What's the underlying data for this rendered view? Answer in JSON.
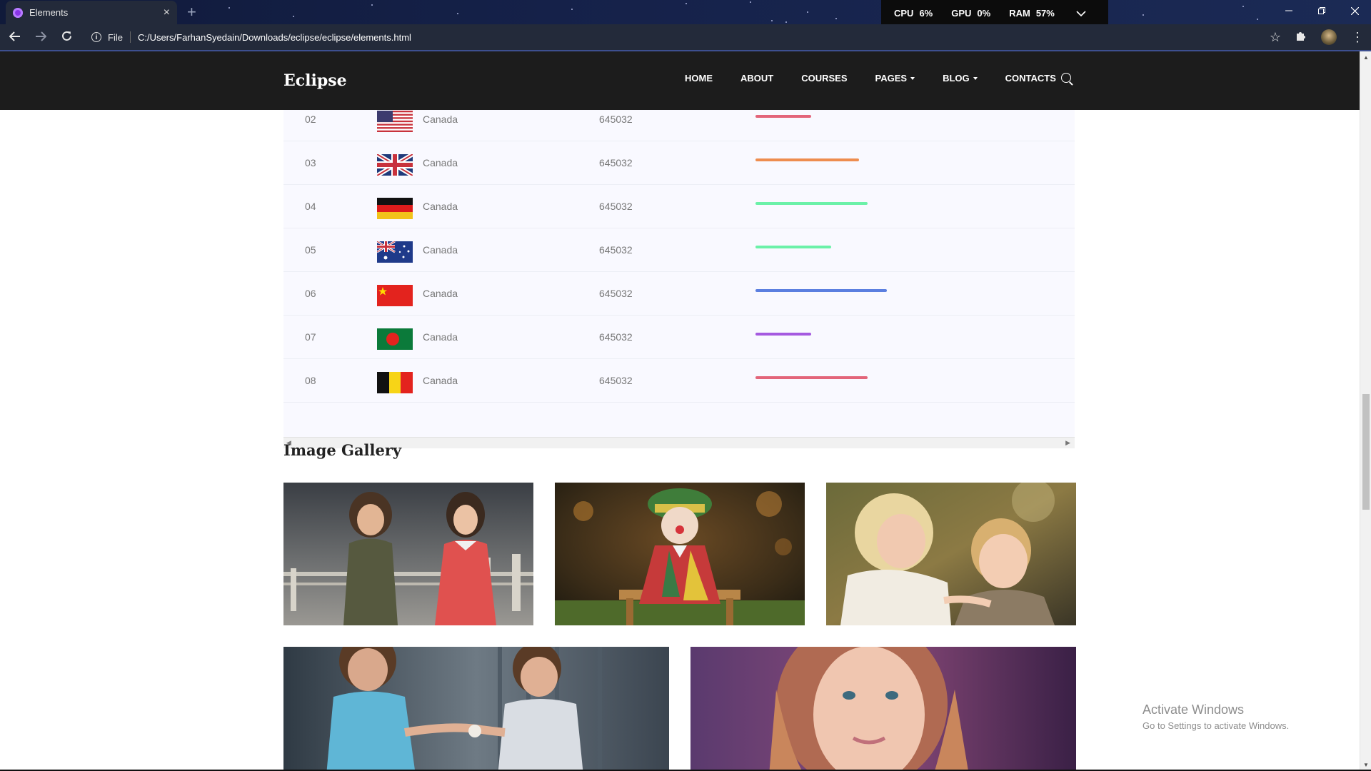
{
  "browser": {
    "tab_title": "Elements",
    "tab_close": "×",
    "new_tab": "+",
    "perf": [
      {
        "label": "CPU",
        "value": "6%"
      },
      {
        "label": "GPU",
        "value": "0%"
      },
      {
        "label": "RAM",
        "value": "57%"
      }
    ],
    "file_label": "File",
    "url": "C:/Users/FarhanSyedain/Downloads/eclipse/eclipse/elements.html"
  },
  "site": {
    "logo": "Eclipse",
    "menu": [
      {
        "label": "HOME",
        "dropdown": false
      },
      {
        "label": "ABOUT",
        "dropdown": false
      },
      {
        "label": "COURSES",
        "dropdown": false
      },
      {
        "label": "PAGES",
        "dropdown": true
      },
      {
        "label": "BLOG",
        "dropdown": true
      },
      {
        "label": "CONTACTS",
        "dropdown": false
      }
    ]
  },
  "table": {
    "rows": [
      {
        "serial": "02",
        "flag": "usa-flag",
        "country": "Canada",
        "visit": "645032",
        "percent": 20,
        "color": "#e3657a"
      },
      {
        "serial": "03",
        "flag": "uk-flag",
        "country": "Canada",
        "visit": "645032",
        "percent": 37,
        "color": "#ee8d4f"
      },
      {
        "serial": "04",
        "flag": "germany-flag",
        "country": "Canada",
        "visit": "645032",
        "percent": 40,
        "color": "#6bf1a8"
      },
      {
        "serial": "05",
        "flag": "australia-flag",
        "country": "Canada",
        "visit": "645032",
        "percent": 27,
        "color": "#6bf1a8"
      },
      {
        "serial": "06",
        "flag": "china-flag",
        "country": "Canada",
        "visit": "645032",
        "percent": 47,
        "color": "#5b7fe0"
      },
      {
        "serial": "07",
        "flag": "bangladesh-flag",
        "country": "Canada",
        "visit": "645032",
        "percent": 20,
        "color": "#a55ae0"
      },
      {
        "serial": "08",
        "flag": "belgium-flag",
        "country": "Canada",
        "visit": "645032",
        "percent": 40,
        "color": "#e3657a"
      }
    ]
  },
  "gallery": {
    "title": "Image Gallery",
    "images": [
      "two-kids-photo",
      "clown-doll-photo",
      "girl-and-boy-photo",
      "children-holding-hands-photo",
      "smiling-girl-photo"
    ]
  },
  "watermark": {
    "line1": "Activate Windows",
    "line2": "Go to Settings to activate Windows."
  }
}
